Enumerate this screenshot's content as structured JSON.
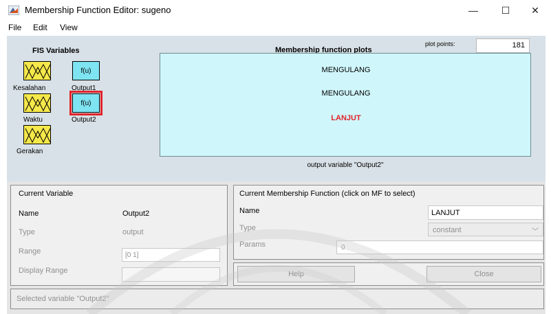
{
  "window": {
    "title": "Membership Function Editor: sugeno",
    "minimize": "—",
    "maximize": "☐",
    "close": "✕"
  },
  "menu": [
    "File",
    "Edit",
    "View"
  ],
  "fis": {
    "heading": "FIS Variables",
    "output_glyph": "f(u)",
    "inputs": [
      "Kesalahan",
      "Waktu",
      "Gerakan"
    ],
    "outputs": [
      "Output1",
      "Output2"
    ]
  },
  "plot": {
    "title": "Membership function plots",
    "plot_points_label": "plot points:",
    "plot_points_value": "181",
    "mf_labels": [
      "MENGULANG",
      "MENGULANG",
      "LANJUT"
    ],
    "caption": "output variable \"Output2\""
  },
  "current_variable": {
    "heading": "Current Variable",
    "name_label": "Name",
    "name_value": "Output2",
    "type_label": "Type",
    "type_value": "output",
    "range_label": "Range",
    "range_value": "[0 1]",
    "display_range_label": "Display Range",
    "display_range_value": ""
  },
  "current_mf": {
    "heading": "Current Membership Function (click on MF to select)",
    "name_label": "Name",
    "name_value": "LANJUT",
    "type_label": "Type",
    "type_value": "constant",
    "params_label": "Params",
    "params_value": "0"
  },
  "buttons": {
    "help": "Help",
    "close": "Close"
  },
  "status": "Selected variable \"Output2\"",
  "colors": {
    "input_var": "#f5e84a",
    "output_var": "#7fe4f1",
    "selected_outline": "#e0242a",
    "plot_bg": "#cff6fb",
    "selected_mf": "#e0242a",
    "panel_bg": "#d8e1e7"
  }
}
